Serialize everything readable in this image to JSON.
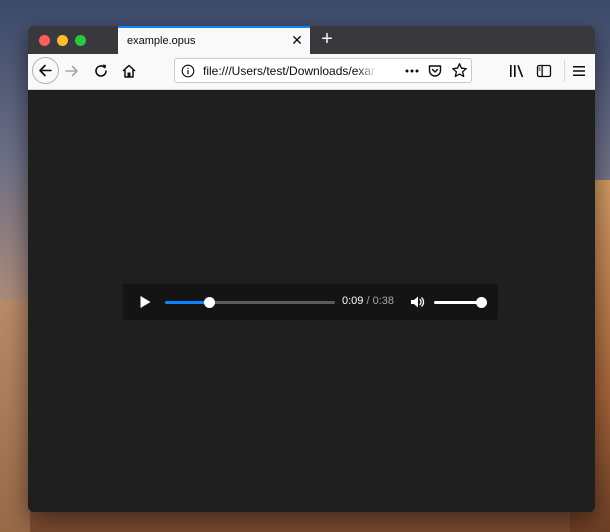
{
  "window": {
    "tab": {
      "title": "example.opus",
      "close_icon": "close-icon"
    },
    "new_tab_icon": "plus-icon"
  },
  "navbar": {
    "url": "file:///Users/test/Downloads/example.opus",
    "icons": [
      "back-arrow-icon",
      "forward-arrow-icon",
      "reload-icon",
      "home-icon",
      "info-icon",
      "more-dots-icon",
      "pocket-icon",
      "star-icon",
      "library-icon",
      "sidebar-icon",
      "hamburger-menu-icon"
    ]
  },
  "player": {
    "current_time": "0:09",
    "separator": " / ",
    "total_time": "0:38",
    "progress_fraction": 0.26,
    "volume_fraction": 1.0
  },
  "colors": {
    "accent": "#0a84ff",
    "tab_strip": "#38383d",
    "toolbar": "#f9f9fa",
    "content_bg": "#1f1f20",
    "player_bg": "#141415"
  }
}
